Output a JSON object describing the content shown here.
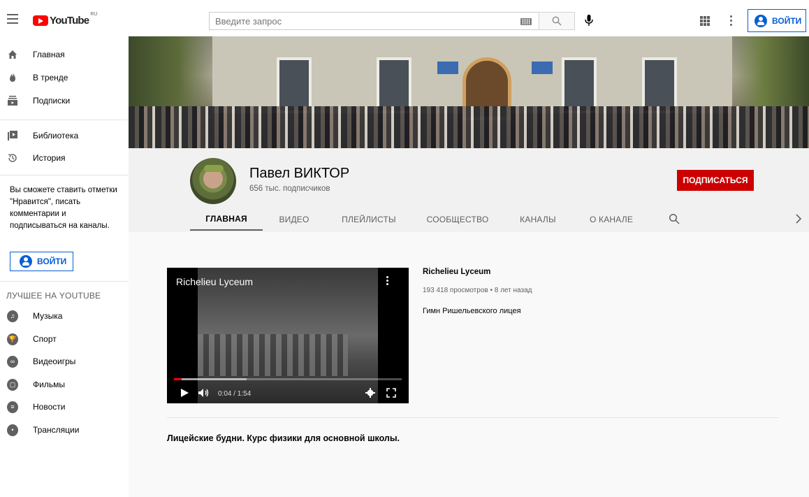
{
  "header": {
    "logo_text": "YouTube",
    "logo_region": "RU",
    "search_placeholder": "Введите запрос",
    "signin_label": "ВОЙТИ"
  },
  "sidebar": {
    "main_items": [
      {
        "label": "Главная",
        "icon": "home-icon"
      },
      {
        "label": "В тренде",
        "icon": "flame-icon"
      },
      {
        "label": "Подписки",
        "icon": "subscriptions-icon"
      }
    ],
    "library_items": [
      {
        "label": "Библиотека",
        "icon": "library-icon"
      },
      {
        "label": "История",
        "icon": "history-icon"
      }
    ],
    "signin_note": "Вы сможете ставить отметки \"Нравится\", писать комментарии и подписываться на каналы.",
    "signin_label": "ВОЙТИ",
    "best_heading": "ЛУЧШЕЕ НА YOUTUBE",
    "best_items": [
      {
        "label": "Музыка",
        "icon": "music-icon"
      },
      {
        "label": "Спорт",
        "icon": "trophy-icon"
      },
      {
        "label": "Видеоигры",
        "icon": "gamepad-icon"
      },
      {
        "label": "Фильмы",
        "icon": "film-icon"
      },
      {
        "label": "Новости",
        "icon": "news-icon"
      },
      {
        "label": "Трансляции",
        "icon": "live-icon"
      }
    ]
  },
  "channel": {
    "name": "Павел ВИКТОР",
    "subscribers": "656 тыс. подписчиков",
    "subscribe_label": "ПОДПИСАТЬСЯ",
    "tabs": [
      "ГЛАВНАЯ",
      "ВИДЕО",
      "ПЛЕЙЛИСТЫ",
      "СООБЩЕСТВО",
      "КАНАЛЫ",
      "О КАНАЛЕ"
    ],
    "active_tab": "ГЛАВНАЯ"
  },
  "featured": {
    "player_title": "Richelieu Lyceum",
    "time": "0:04 / 1:54",
    "progress_fraction": 0.035,
    "buffer_fraction": 0.32,
    "title": "Richelieu Lyceum",
    "meta": "193 418 просмотров • 8 лет назад",
    "description": "Гимн Ришельевского лицея"
  },
  "shelf": {
    "title": "Лицейские будни. Курс физики для основной школы."
  },
  "colors": {
    "accent_blue": "#065fd4",
    "subscribe_red": "#cc0000",
    "progress_red": "#ff0000"
  }
}
